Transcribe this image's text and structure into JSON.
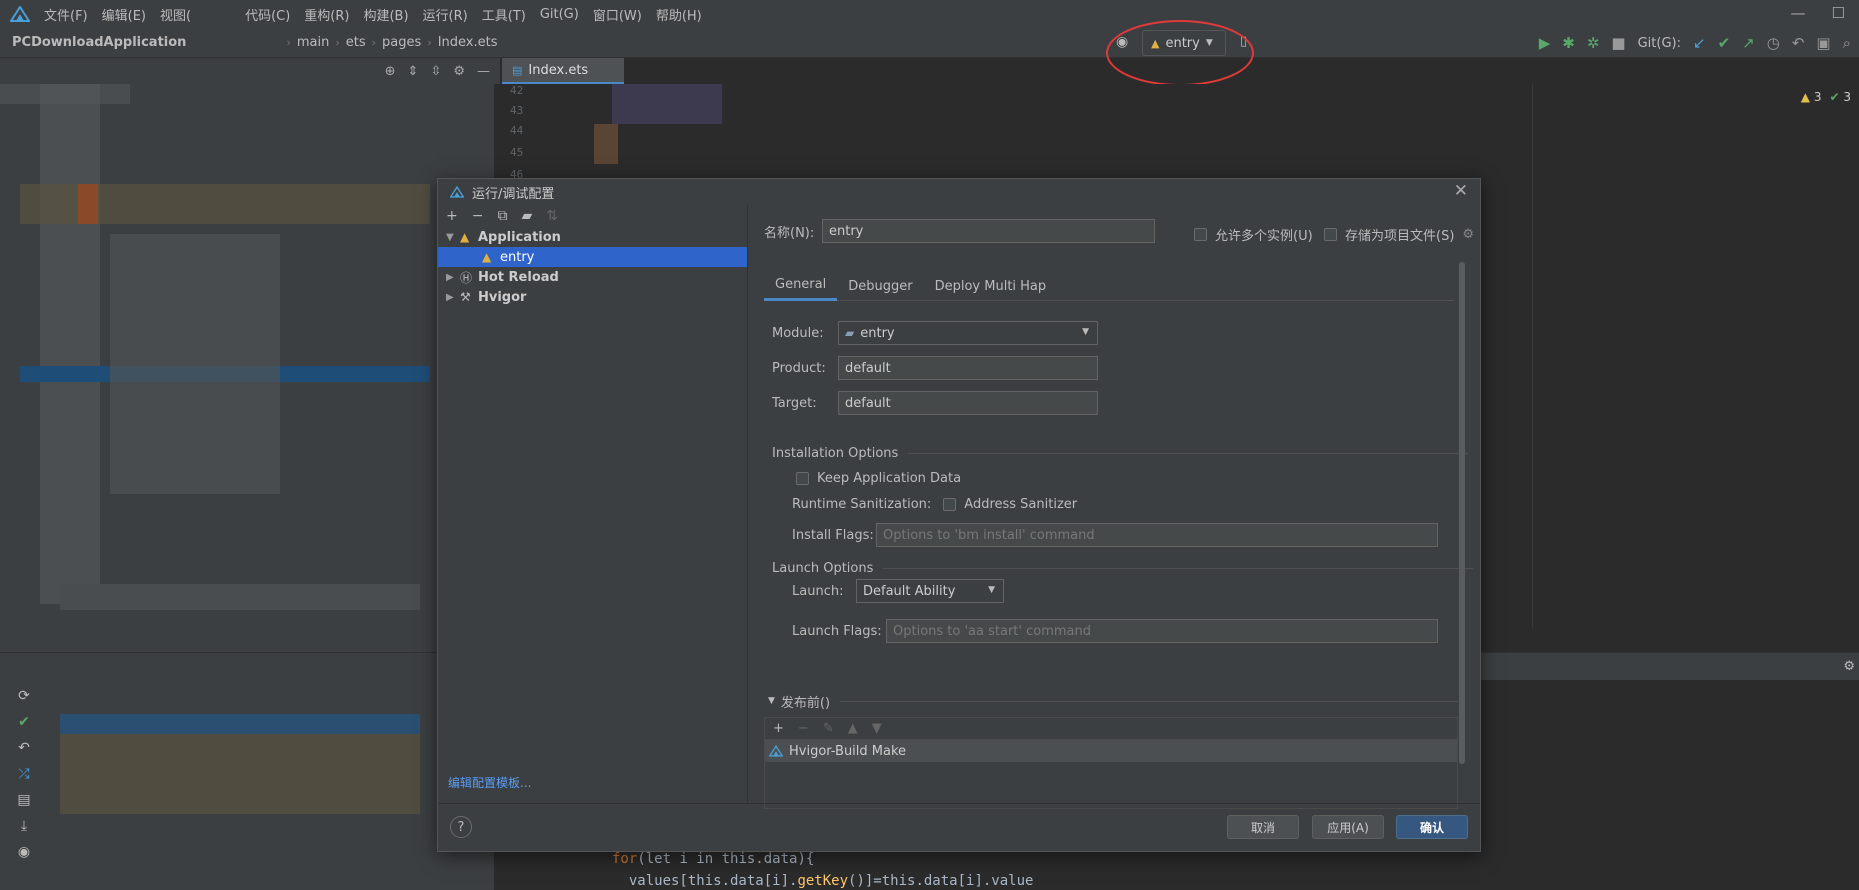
{
  "menubar": {
    "items": [
      "文件(F)",
      "编辑(E)",
      "视图(",
      "代码(C)",
      "重构(R)",
      "构建(B)",
      "运行(R)",
      "工具(T)",
      "Git(G)",
      "窗口(W)",
      "帮助(H)"
    ]
  },
  "navbar": {
    "project": "PCDownloadApplication",
    "breadcrumbs": [
      "main",
      "ets",
      "pages",
      "Index.ets"
    ],
    "run_config": "entry",
    "git_label": "Git(G):"
  },
  "editor": {
    "tab": "Index.ets",
    "line_numbers": [
      "42",
      "43",
      "44",
      "45",
      "46"
    ],
    "warnings": "3",
    "checks": "3",
    "bottom_code": {
      "line1_kw": "for",
      "line1_rest": "(let i in this.data){",
      "line2_a": "values[this.data[i].",
      "line2_fn": "getKey",
      "line2_b": "()]=this.data[i].value"
    }
  },
  "dialog": {
    "title": "运行/调试配置",
    "tree": {
      "application": "Application",
      "entry": "entry",
      "hot_reload": "Hot Reload",
      "hvigor": "Hvigor"
    },
    "edit_templates": "编辑配置模板...",
    "name_label": "名称(N):",
    "name_value": "entry",
    "allow_multiple": "允许多个实例(U)",
    "store_as_project": "存储为项目文件(S)",
    "tabs": [
      "General",
      "Debugger",
      "Deploy Multi Hap"
    ],
    "module_label": "Module:",
    "module_value": "entry",
    "product_label": "Product:",
    "product_value": "default",
    "target_label": "Target:",
    "target_value": "default",
    "installation_options": "Installation Options",
    "keep_app_data": "Keep Application Data",
    "runtime_sanitization": "Runtime Sanitization:",
    "address_sanitizer": "Address Sanitizer",
    "install_flags_label": "Install Flags:",
    "install_flags_placeholder": "Options to 'bm install' command",
    "launch_options": "Launch Options",
    "launch_label": "Launch:",
    "launch_value": "Default Ability",
    "launch_flags_label": "Launch Flags:",
    "launch_flags_placeholder": "Options to 'aa start' command",
    "before_launch": "发布前()",
    "before_launch_item": "Hvigor-Build Make",
    "buttons": {
      "cancel": "取消",
      "apply": "应用(A)",
      "ok": "确认"
    }
  }
}
